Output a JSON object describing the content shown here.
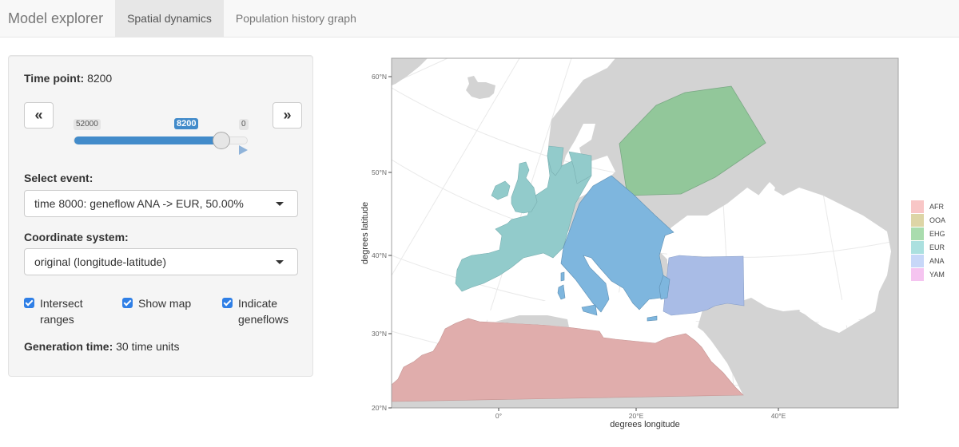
{
  "navbar": {
    "brand": "Model explorer",
    "tabs": [
      {
        "label": "Spatial dynamics",
        "active": true
      },
      {
        "label": "Population history graph",
        "active": false
      }
    ]
  },
  "sidebar": {
    "time_point_label": "Time point:",
    "time_point_value": "8200",
    "prev_button": "«",
    "next_button": "»",
    "slider": {
      "min_label": "52000",
      "max_label": "0",
      "current_label": "8200",
      "min": 52000,
      "max": 0,
      "value": 8200
    },
    "select_event_label": "Select event:",
    "select_event_value": "time 8000: geneflow ANA -> EUR, 50.00%",
    "coord_system_label": "Coordinate system:",
    "coord_system_value": "original (longitude-latitude)",
    "checkboxes": [
      {
        "label_line1": "Intersect",
        "label_line2": "ranges",
        "checked": true
      },
      {
        "label_line1": "Show map",
        "label_line2": "",
        "checked": true
      },
      {
        "label_line1": "Indicate",
        "label_line2": "geneflows",
        "checked": true
      }
    ],
    "generation_time_label": "Generation time:",
    "generation_time_value": "30 time units"
  },
  "map": {
    "xlabel": "degrees longitude",
    "ylabel": "degrees latitude",
    "x_ticks": [
      "0°",
      "20°E",
      "40°E"
    ],
    "y_ticks": [
      "60°N",
      "50°N",
      "40°N",
      "30°N",
      "20°N"
    ],
    "colors": {
      "land": "#d3d3d3",
      "sea": "#ffffff",
      "AFR": "#e0adac",
      "EHG": "#92c79a",
      "EUR": "#92cbcb",
      "ANA": "#a9bce6",
      "EUR_ANA_overlap": "#7eb6de"
    }
  },
  "legend": [
    {
      "label": "AFR",
      "color": "#f8c6c6"
    },
    {
      "label": "OOA",
      "color": "#ddd5a6"
    },
    {
      "label": "EHG",
      "color": "#a9dcae"
    },
    {
      "label": "EUR",
      "color": "#abe0df"
    },
    {
      "label": "ANA",
      "color": "#c7d7f8"
    },
    {
      "label": "YAM",
      "color": "#f5c4f0"
    }
  ]
}
